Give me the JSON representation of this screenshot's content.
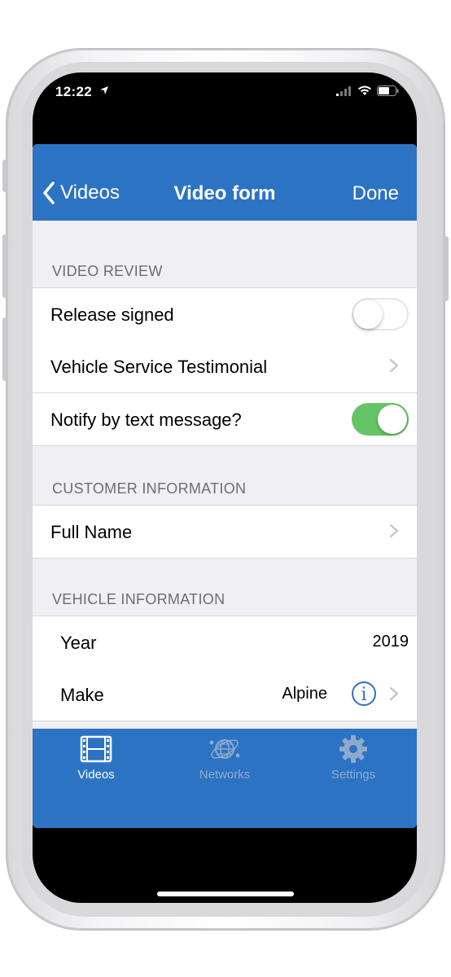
{
  "status_bar": {
    "time": "12:22"
  },
  "navbar": {
    "back_label": "Videos",
    "title": "Video form",
    "done_label": "Done"
  },
  "sections": {
    "video_review": {
      "header": "VIDEO REVIEW",
      "release_signed": {
        "label": "Release signed",
        "value": false
      },
      "testimonial": {
        "label": "Vehicle Service Testimonial"
      },
      "notify": {
        "label": "Notify by text message?",
        "value": true
      }
    },
    "customer": {
      "header": "CUSTOMER INFORMATION",
      "full_name": {
        "label": "Full Name"
      }
    },
    "vehicle": {
      "header": "VEHICLE INFORMATION",
      "year": {
        "label": "Year",
        "value": "2019"
      },
      "make": {
        "label": "Make",
        "value": "Alpine"
      }
    }
  },
  "tabbar": {
    "tabs": [
      {
        "label": "Videos",
        "icon": "film-icon",
        "active": true
      },
      {
        "label": "Networks",
        "icon": "globe-network-icon",
        "active": false
      },
      {
        "label": "Settings",
        "icon": "gear-icon",
        "active": false
      }
    ]
  },
  "colors": {
    "accent": "#2d73c4",
    "toggle_on": "#65c466",
    "background": "#efeff4"
  }
}
